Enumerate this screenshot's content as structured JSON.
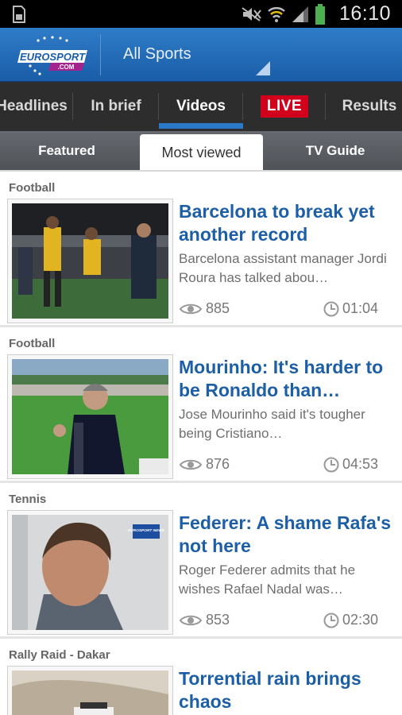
{
  "status_bar": {
    "time": "16:10",
    "icons": [
      "sd-card-icon",
      "mute-icon",
      "wifi-icon",
      "signal-icon",
      "battery-icon"
    ]
  },
  "header": {
    "logo_text_top": "EUROSPORT",
    "logo_text_bottom": ".COM",
    "section": "All Sports"
  },
  "main_tabs": [
    {
      "label": "Headlines"
    },
    {
      "label": "In brief"
    },
    {
      "label": "Videos",
      "active": true
    },
    {
      "label": "LIVE"
    },
    {
      "label": "Results"
    }
  ],
  "sub_tabs": [
    {
      "label": "Featured"
    },
    {
      "label": "Most viewed",
      "active": true
    },
    {
      "label": "TV Guide"
    }
  ],
  "articles": [
    {
      "category": "Football",
      "title": "Barcelona to break yet another record",
      "summary": "Barcelona assistant manager Jordi Roura has talked abou…",
      "views": "885",
      "duration": "01:04"
    },
    {
      "category": "Football",
      "title": "Mourinho: It's harder to be Ronaldo than…",
      "summary": "Jose Mourinho said it's tougher being Cristiano…",
      "views": "876",
      "duration": "04:53"
    },
    {
      "category": "Tennis",
      "title": "Federer: A shame Rafa's not here",
      "summary": "Roger Federer admits that he wishes Rafael Nadal was…",
      "views": "853",
      "duration": "02:30",
      "thumb_badge": "EUROSPORT NEWS"
    },
    {
      "category": "Rally Raid - Dakar",
      "title": "Torrential rain brings chaos",
      "summary": "",
      "views": "",
      "duration": ""
    }
  ],
  "colors": {
    "brand_blue": "#1d5fa7",
    "live_red": "#d1001c",
    "active_underline": "#2a79c9"
  }
}
